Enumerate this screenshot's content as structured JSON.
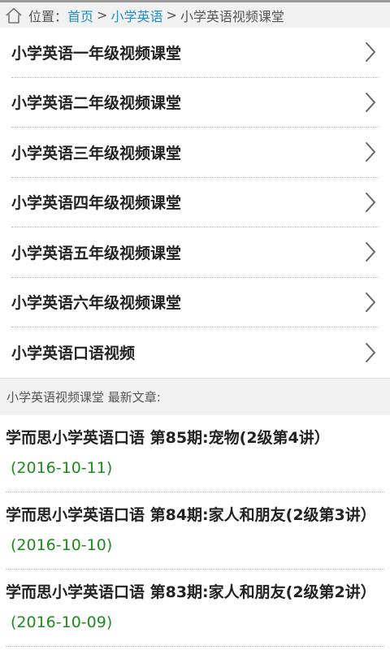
{
  "breadcrumb": {
    "prefix": "位置：",
    "home": "首页",
    "separator": ">",
    "section": "小学英语",
    "current": "小学英语视频课堂"
  },
  "categories": [
    {
      "label": "小学英语一年级视频课堂"
    },
    {
      "label": "小学英语二年级视频课堂"
    },
    {
      "label": "小学英语三年级视频课堂"
    },
    {
      "label": "小学英语四年级视频课堂"
    },
    {
      "label": "小学英语五年级视频课堂"
    },
    {
      "label": "小学英语六年级视频课堂"
    },
    {
      "label": "小学英语口语视频"
    }
  ],
  "latest": {
    "heading": "小学英语视频课堂 最新文章:",
    "articles": [
      {
        "title": "学而思小学英语口语 第85期:宠物(2级第4讲）",
        "date": "(2016-10-11)"
      },
      {
        "title": "学而思小学英语口语 第84期:家人和朋友(2级第3讲）",
        "date": "(2016-10-10)"
      },
      {
        "title": "学而思小学英语口语 第83期:家人和朋友(2级第2讲）",
        "date": "(2016-10-09)"
      }
    ]
  },
  "icons": {
    "home": "home-icon",
    "chevron": "chevron-right-icon"
  },
  "colors": {
    "link": "#1a8fd1",
    "date": "#1f8a1f",
    "header_bg": "#f1f1f1"
  }
}
